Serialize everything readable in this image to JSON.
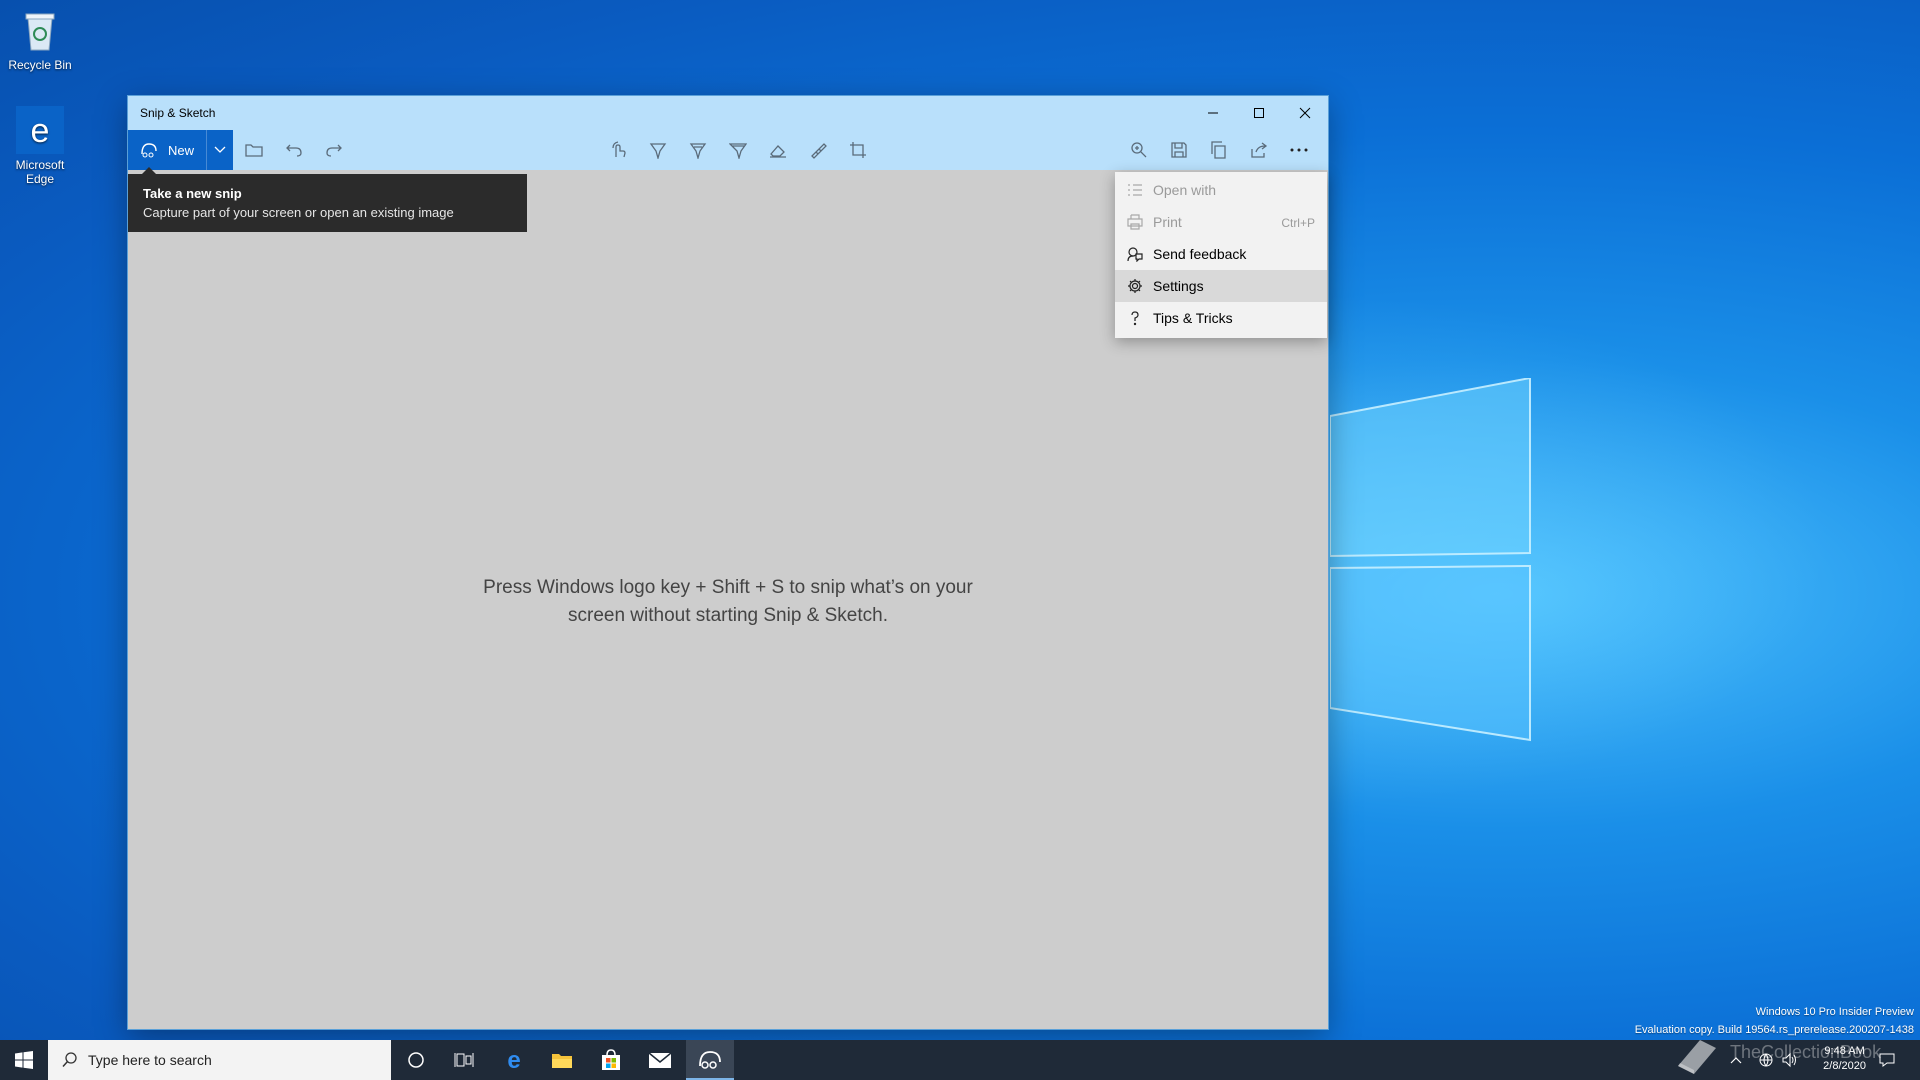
{
  "desktop": {
    "icons": [
      {
        "label": "Recycle Bin"
      },
      {
        "label": "Microsoft Edge"
      }
    ],
    "watermark": {
      "line1": "Windows 10 Pro Insider Preview",
      "line2": "Evaluation copy. Build 19564.rs_prerelease.200207-1438"
    },
    "brand": "TheCollectionBook"
  },
  "window": {
    "title": "Snip & Sketch",
    "new_label": "New",
    "canvas_message_line1": "Press Windows logo key + Shift + S to snip what’s on your",
    "canvas_message_line2": "screen without starting Snip & Sketch.",
    "toolbar_icons": [
      "open-file-icon",
      "undo-icon",
      "redo-icon",
      "touch-writing-icon",
      "ballpoint-pen-icon",
      "pencil-icon",
      "highlighter-icon",
      "eraser-icon",
      "ruler-icon",
      "crop-icon",
      "zoom-icon",
      "save-icon",
      "copy-icon",
      "share-icon",
      "more-icon"
    ]
  },
  "tooltip": {
    "title": "Take a new snip",
    "description": "Capture part of your screen or open an existing image"
  },
  "menu": {
    "items": [
      {
        "label": "Open with",
        "shortcut": "",
        "disabled": true,
        "icon": "open-with-icon"
      },
      {
        "label": "Print",
        "shortcut": "Ctrl+P",
        "disabled": true,
        "icon": "printer-icon"
      },
      {
        "label": "Send feedback",
        "shortcut": "",
        "disabled": false,
        "icon": "feedback-icon"
      },
      {
        "label": "Settings",
        "shortcut": "",
        "disabled": false,
        "icon": "gear-icon"
      },
      {
        "label": "Tips & Tricks",
        "shortcut": "",
        "disabled": false,
        "icon": "question-icon"
      }
    ]
  },
  "taskbar": {
    "search_placeholder": "Type here to search",
    "time": "9:48 AM",
    "date": "2/8/2020"
  }
}
